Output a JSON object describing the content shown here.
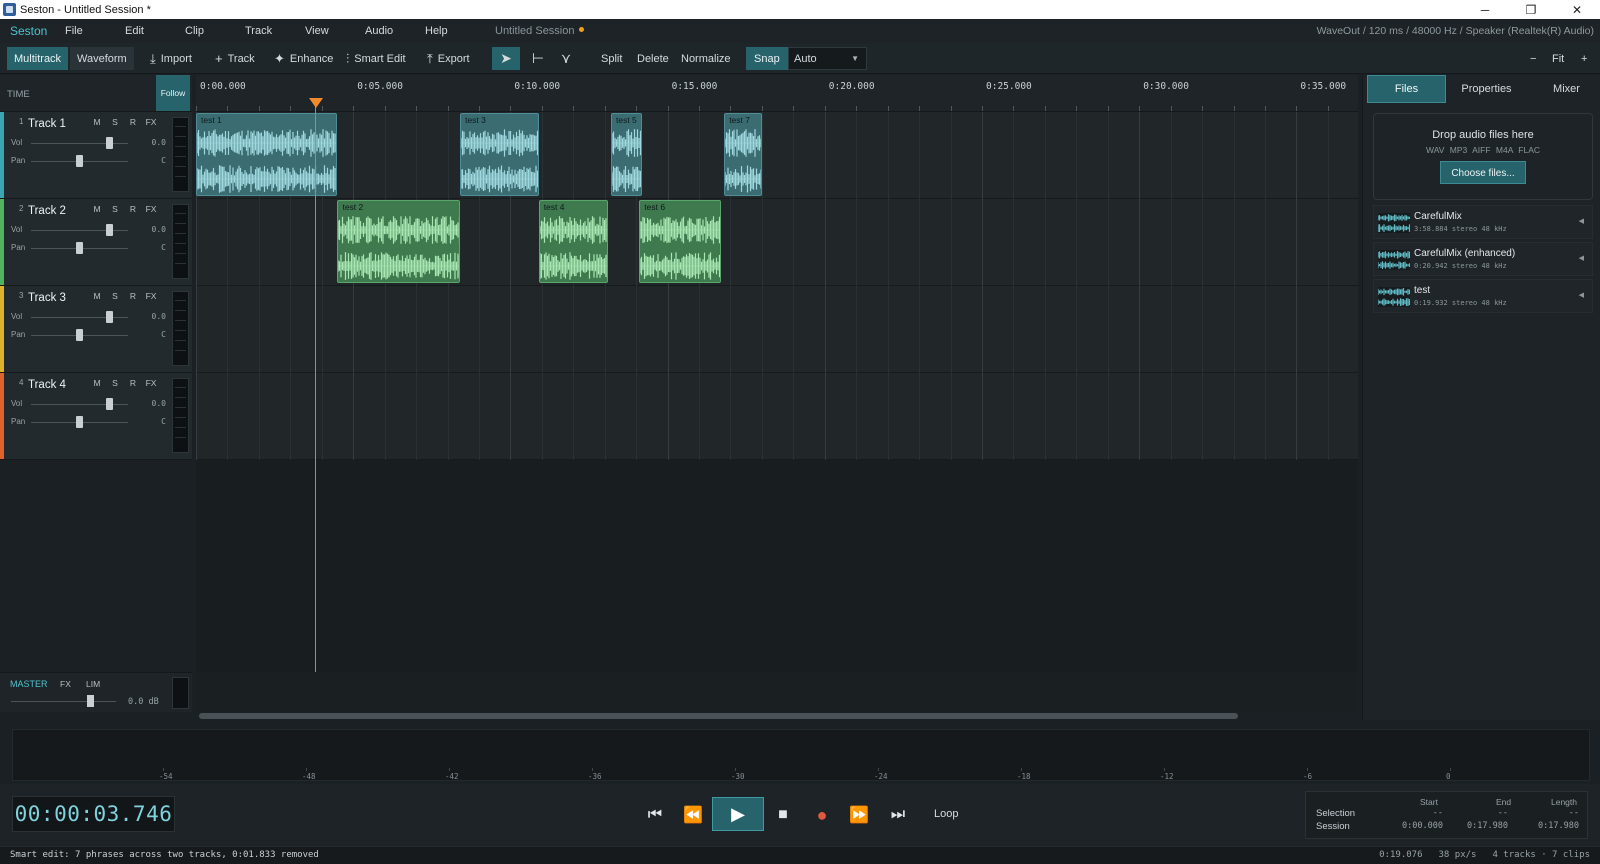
{
  "window": {
    "title": "Seston - Untitled Session *",
    "controls": {
      "minimize": "─",
      "maximize": "❐",
      "close": "✕"
    }
  },
  "menubar": {
    "brand": "Seston",
    "menus": [
      "File",
      "Edit",
      "Clip",
      "Track",
      "View",
      "Audio",
      "Help"
    ],
    "session_name": "Untitled Session",
    "device_info": "WaveOut / 120 ms / 48000 Hz / Speaker (Realtek(R) Audio)"
  },
  "toolbar": {
    "multitrack": "Multitrack",
    "waveform": "Waveform",
    "import": "Import",
    "track": "Track",
    "enhance": "Enhance",
    "smart_edit": "Smart Edit",
    "export": "Export",
    "split": "Split",
    "delete": "Delete",
    "normalize": "Normalize",
    "snap": "Snap",
    "snap_mode": "Auto",
    "zoom_out": "−",
    "fit": "Fit",
    "zoom_in": "+"
  },
  "ruler": {
    "time_label": "TIME",
    "follow": "Follow",
    "ticks": [
      "0:00.000",
      "0:05.000",
      "0:10.000",
      "0:15.000",
      "0:20.000",
      "0:25.000",
      "0:30.000",
      "0:35.000"
    ]
  },
  "tracks": [
    {
      "number": "1",
      "name": "Track 1",
      "color": "#3aa6b0",
      "vol_label": "Vol",
      "pan_label": "Pan",
      "vol_value": "0.0",
      "pan_value": "C",
      "buttons": [
        "M",
        "S",
        "R",
        "FX"
      ]
    },
    {
      "number": "2",
      "name": "Track 2",
      "color": "#4fb35f",
      "vol_label": "Vol",
      "pan_label": "Pan",
      "vol_value": "0.0",
      "pan_value": "C",
      "buttons": [
        "M",
        "S",
        "R",
        "FX"
      ]
    },
    {
      "number": "3",
      "name": "Track 3",
      "color": "#e0b22a",
      "vol_label": "Vol",
      "pan_label": "Pan",
      "vol_value": "0.0",
      "pan_value": "C",
      "buttons": [
        "M",
        "S",
        "R",
        "FX"
      ]
    },
    {
      "number": "4",
      "name": "Track 4",
      "color": "#e0622a",
      "vol_label": "Vol",
      "pan_label": "Pan",
      "vol_value": "0.0",
      "pan_value": "C",
      "buttons": [
        "M",
        "S",
        "R",
        "FX"
      ]
    }
  ],
  "clips": [
    {
      "name": "test 1",
      "track": 1,
      "start": 0.0,
      "end": 4.5,
      "color": "teal"
    },
    {
      "name": "test 3",
      "track": 1,
      "start": 8.4,
      "end": 10.9,
      "color": "teal"
    },
    {
      "name": "test 5",
      "track": 1,
      "start": 13.2,
      "end": 14.2,
      "color": "teal"
    },
    {
      "name": "test 7",
      "track": 1,
      "start": 16.8,
      "end": 18.0,
      "color": "teal"
    },
    {
      "name": "test 2",
      "track": 2,
      "start": 4.5,
      "end": 8.4,
      "color": "green"
    },
    {
      "name": "test 4",
      "track": 2,
      "start": 10.9,
      "end": 13.1,
      "color": "green"
    },
    {
      "name": "test 6",
      "track": 2,
      "start": 14.1,
      "end": 16.7,
      "color": "green"
    }
  ],
  "master": {
    "label": "MASTER",
    "fx": "FX",
    "lim": "LIM",
    "db": "0.0 dB"
  },
  "right_panel": {
    "tabs": [
      "Files",
      "Properties",
      "Mixer"
    ],
    "drop_title": "Drop audio files here",
    "formats": "WAV MP3 AIFF M4A FLAC",
    "choose_files": "Choose files...",
    "files": [
      {
        "name": "CarefulMix",
        "meta": "3:58.884  stereo  48 kHz"
      },
      {
        "name": "CarefulMix (enhanced)",
        "meta": "0:20.942  stereo  48 kHz"
      },
      {
        "name": "test",
        "meta": "0:19.932  stereo  48 kHz"
      }
    ]
  },
  "meter_scale": [
    "-54",
    "-48",
    "-42",
    "-36",
    "-30",
    "-24",
    "-18",
    "-12",
    "-6",
    "0"
  ],
  "transport": {
    "timecode": "00:00:03.746",
    "loop": "Loop",
    "icons": {
      "to_start": "⏮",
      "rewind": "⏪",
      "play": "▶",
      "stop": "■",
      "record": "●",
      "forward": "⏩",
      "to_end": "⏭"
    }
  },
  "selection": {
    "headers": [
      "Start",
      "End",
      "Length"
    ],
    "selection_label": "Selection",
    "session_label": "Session",
    "selection_values": [
      "--",
      "--",
      "--"
    ],
    "session_values": [
      "0:00.000",
      "0:17.980",
      "0:17.980"
    ]
  },
  "status": {
    "message": "Smart edit: 7 phrases across two tracks, 0:01.833 removed",
    "position": "0:19.076",
    "zoom": "38 px/s",
    "summary": "4 tracks · 7 clips"
  }
}
